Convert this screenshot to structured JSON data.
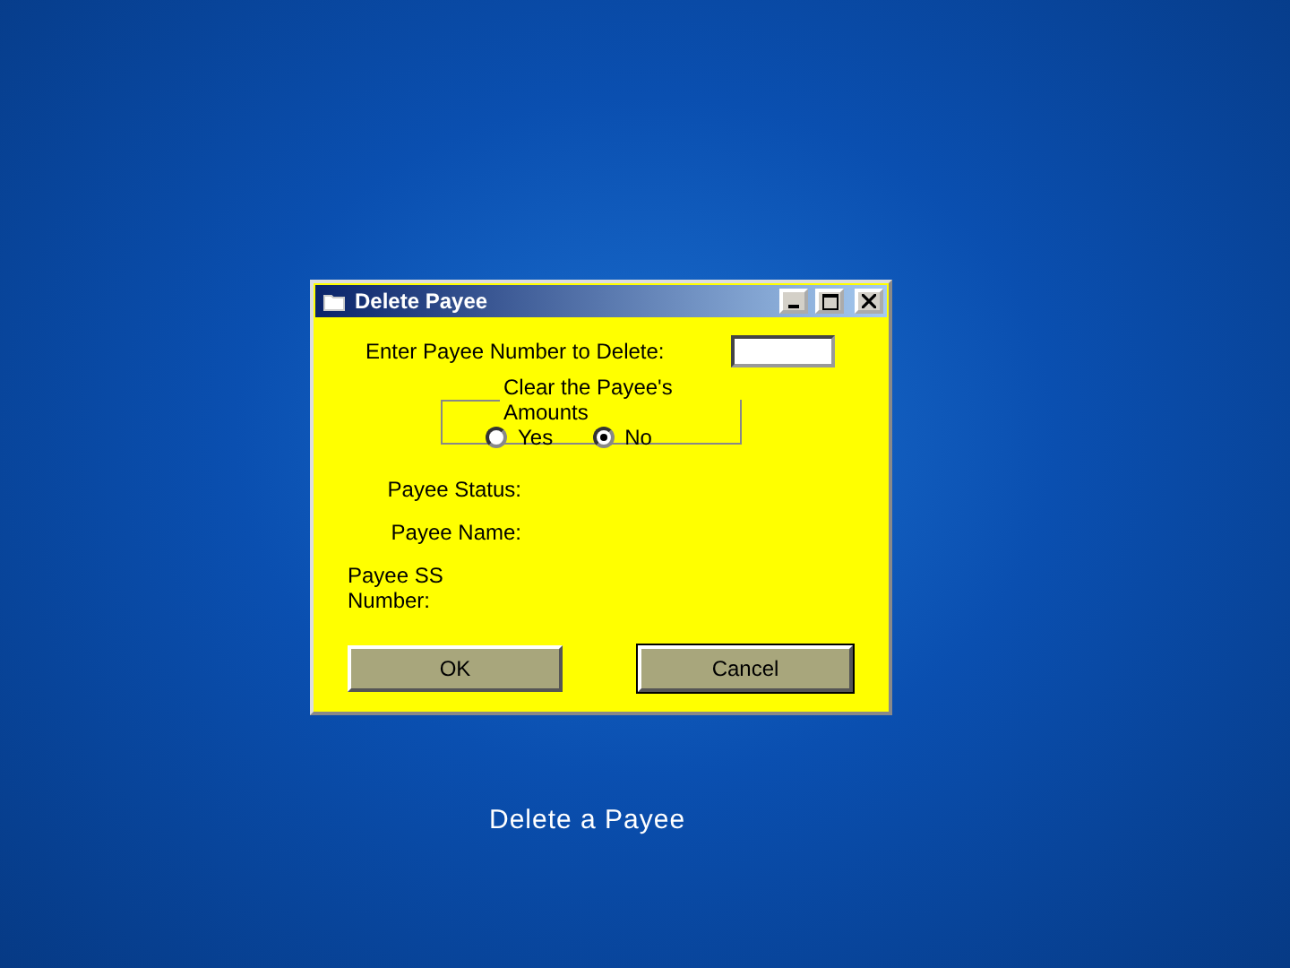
{
  "window": {
    "title": "Delete Payee"
  },
  "prompt": {
    "label": "Enter Payee Number to Delete:"
  },
  "clear_amounts": {
    "legend": "Clear the Payee's Amounts",
    "options": [
      {
        "label": "Yes",
        "selected": false
      },
      {
        "label": "No",
        "selected": true
      }
    ]
  },
  "fields": [
    "Payee Status:",
    "Payee Name:",
    "Payee SS Number:"
  ],
  "buttons": [
    {
      "label": "OK",
      "default": false
    },
    {
      "label": "Cancel",
      "default": true
    }
  ],
  "caption": "Delete a Payee"
}
